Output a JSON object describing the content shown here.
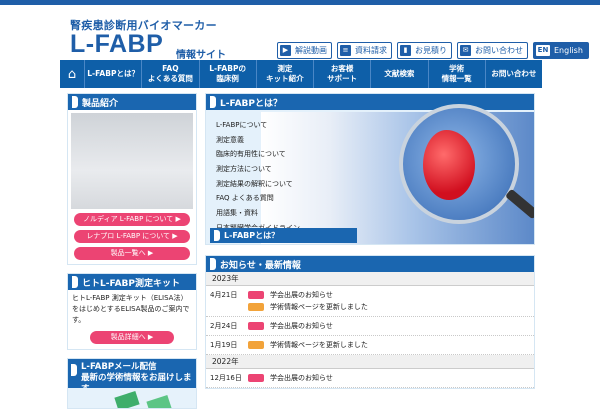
{
  "site": {
    "tagline": "腎疾患診断用バイオマーカー",
    "logo": "L-FABP",
    "logo_sub": "情報サイト"
  },
  "header_buttons": [
    {
      "icon": "play-icon",
      "label": "解説動画"
    },
    {
      "icon": "document-icon",
      "label": "資料請求"
    },
    {
      "icon": "bookmark-icon",
      "label": "お見積り"
    },
    {
      "icon": "mail-icon",
      "label": "お問い合わせ"
    },
    {
      "icon": "en-icon",
      "icon_text": "EN",
      "label": "English"
    }
  ],
  "nav": {
    "home_icon": "home-icon",
    "items": [
      {
        "line1": "L-FABPとは？",
        "line2": ""
      },
      {
        "line1": "FAQ",
        "line2": "よくある質問"
      },
      {
        "line1": "L-FABPの",
        "line2": "臨床例"
      },
      {
        "line1": "測定",
        "line2": "キット紹介"
      },
      {
        "line1": "お客様",
        "line2": "サポート"
      },
      {
        "line1": "文献検索",
        "line2": ""
      },
      {
        "line1": "学術",
        "line2": "情報一覧"
      },
      {
        "line1": "お問い合わせ",
        "line2": ""
      }
    ]
  },
  "sidebar": {
    "product": {
      "title": "製品紹介",
      "buttons": [
        "ノルディア L-FABP について",
        "レナプロ L-FABP について",
        "製品一覧へ"
      ]
    },
    "elisa": {
      "title": "ヒトL-FABP測定キット",
      "text": "ヒトL-FABP 測定キット（ELISA法）をはじめとするELISA製品のご案内です。",
      "button": "製品詳細へ"
    },
    "mail": {
      "title_line1": "L-FABPメール配信",
      "title_line2": "最新の学術情報をお届けします"
    }
  },
  "feature": {
    "title": "L-FABPとは？",
    "links": [
      "L-FABPについて",
      "測定意義",
      "臨床的有用性について",
      "測定方法について",
      "測定結果の解釈について",
      "FAQ よくある質問",
      "用語集・資料",
      "日本腎臓学会ガイドライン"
    ],
    "bar": "L-FABPとは？"
  },
  "news": {
    "title": "お知らせ・最新情報",
    "groups": [
      {
        "year": "2023年",
        "rows": [
          {
            "date": "4月21日",
            "items": [
              {
                "tag": "pink",
                "title": "学会出展のお知らせ"
              },
              {
                "tag": "orange",
                "title": "学術情報ページを更新しました"
              }
            ]
          },
          {
            "date": "2月24日",
            "items": [
              {
                "tag": "pink",
                "title": "学会出展のお知らせ"
              }
            ]
          },
          {
            "date": "1月19日",
            "items": [
              {
                "tag": "orange",
                "title": "学術情報ページを更新しました"
              }
            ]
          }
        ]
      },
      {
        "year": "2022年",
        "rows": [
          {
            "date": "12月16日",
            "items": [
              {
                "tag": "pink",
                "title": "学会出展のお知らせ"
              }
            ]
          }
        ]
      }
    ]
  },
  "colors": {
    "brand": "#1f5ea8",
    "nav": "#0e5fa8",
    "accent_pink": "#ec4473",
    "accent_orange": "#f2a33a"
  }
}
